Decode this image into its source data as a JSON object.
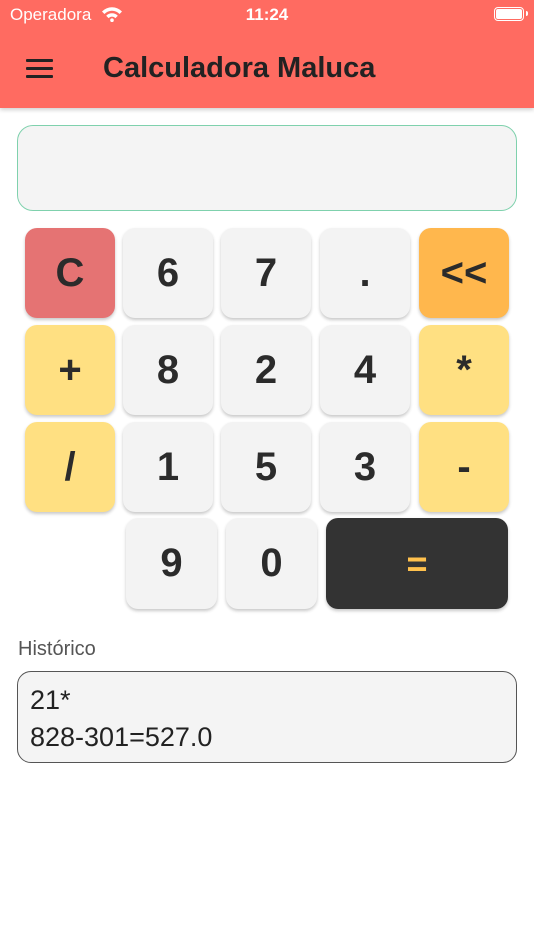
{
  "status": {
    "carrier": "Operadora",
    "time": "11:24"
  },
  "appbar": {
    "title": "Calculadora Maluca",
    "menu_icon": "menu-icon"
  },
  "display": {
    "value": ""
  },
  "keys": {
    "clear": "C",
    "k6": "6",
    "k7": "7",
    "dot": ".",
    "back": "<<",
    "plus": "+",
    "k8": "8",
    "k2": "2",
    "k4": "4",
    "times": "*",
    "divide": "/",
    "k1": "1",
    "k5": "5",
    "k3": "3",
    "minus": "-",
    "k9": "9",
    "k0": "0",
    "equals": "="
  },
  "history": {
    "label": "Histórico",
    "lines": [
      "21*",
      "828-301=527.0"
    ]
  },
  "colors": {
    "appbar": "#ff6b61",
    "clear": "#e57373",
    "operator": "#ffe082",
    "backspace": "#ffb74d",
    "equals_bg": "#333333",
    "equals_text": "#ffc14d"
  }
}
